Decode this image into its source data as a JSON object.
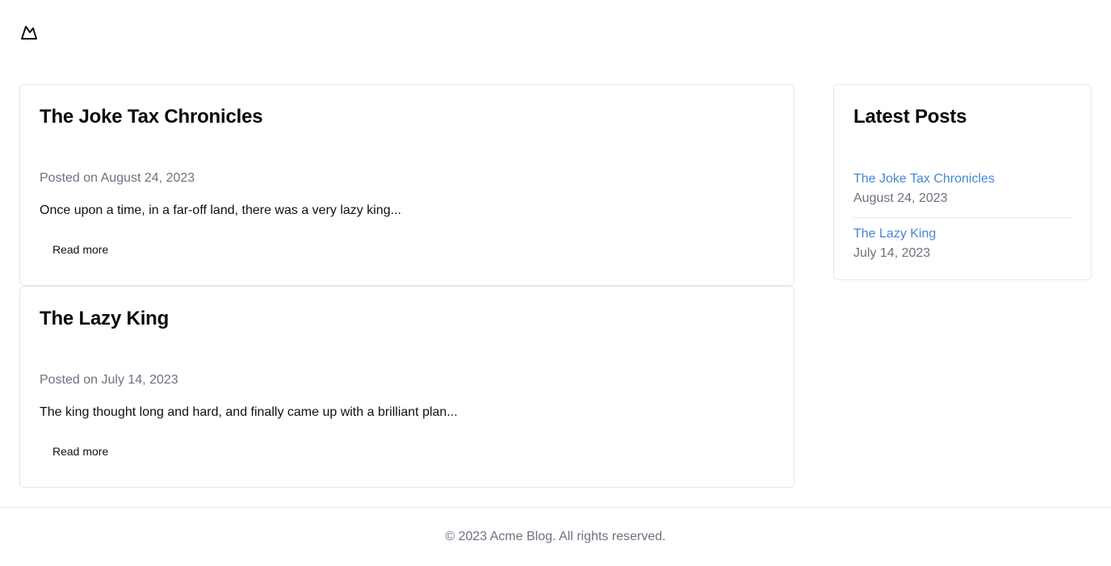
{
  "header": {
    "logo_icon": "mountain-logo-icon"
  },
  "posts": [
    {
      "title": "The Joke Tax Chronicles",
      "meta": "Posted on August 24, 2023",
      "excerpt": "Once upon a time, in a far-off land, there was a very lazy king...",
      "read_more_label": "Read more"
    },
    {
      "title": "The Lazy King",
      "meta": "Posted on July 14, 2023",
      "excerpt": "The king thought long and hard, and finally came up with a brilliant plan...",
      "read_more_label": "Read more"
    }
  ],
  "sidebar": {
    "title": "Latest Posts",
    "items": [
      {
        "title": "The Joke Tax Chronicles",
        "date": "August 24, 2023"
      },
      {
        "title": "The Lazy King",
        "date": "July 14, 2023"
      }
    ]
  },
  "footer": {
    "text": "© 2023 Acme Blog. All rights reserved."
  },
  "colors": {
    "link": "#4a86d4",
    "muted": "#6b7280",
    "border": "#e5e7eb",
    "text": "#111111"
  }
}
